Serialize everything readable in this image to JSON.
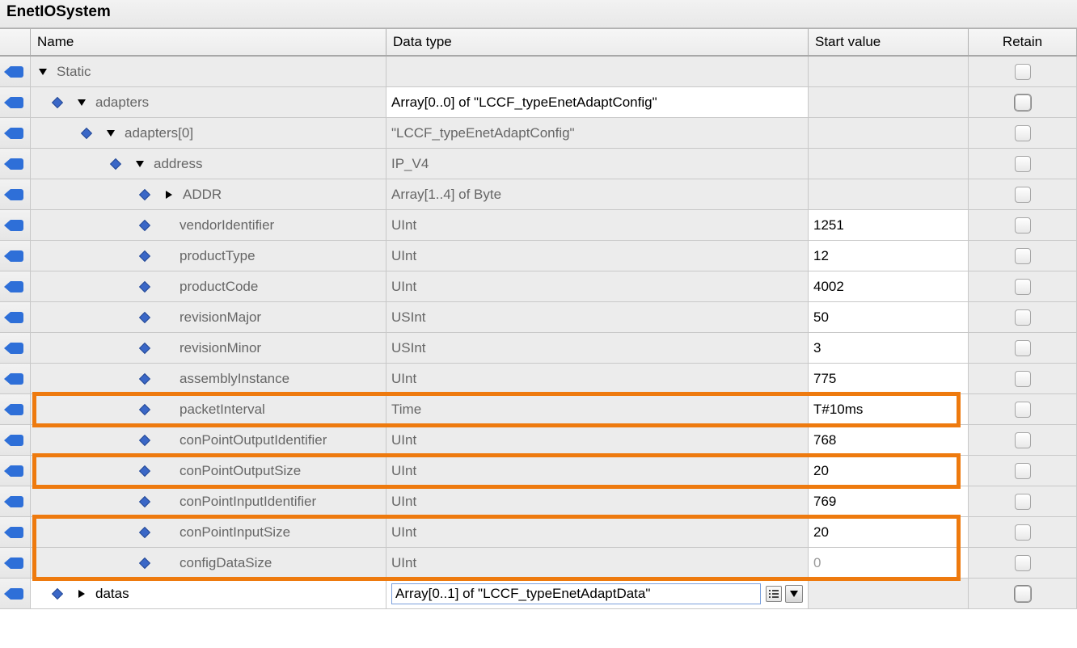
{
  "window_title": "EnetIOSystem",
  "columns": {
    "name": "Name",
    "datatype": "Data type",
    "start": "Start value",
    "retain": "Retain"
  },
  "rows": [
    {
      "id": "static",
      "indent": 0,
      "toggle": "down",
      "bullet": false,
      "name": "Static",
      "type": "",
      "start": "",
      "start_gray": true,
      "name_bg": "gray",
      "type_gray": true,
      "retain_thick": false,
      "highlight": false
    },
    {
      "id": "adapters",
      "indent": 1,
      "toggle": "down",
      "bullet": true,
      "name": "adapters",
      "type": "Array[0..0] of \"LCCF_typeEnetAdaptConfig\"",
      "start": "",
      "start_gray": true,
      "name_bg": "gray",
      "type_gray": false,
      "retain_thick": true,
      "highlight": false
    },
    {
      "id": "adapters0",
      "indent": 2,
      "toggle": "down",
      "bullet": true,
      "name": "adapters[0]",
      "type": "\"LCCF_typeEnetAdaptConfig\"",
      "start": "",
      "start_gray": true,
      "name_bg": "gray",
      "type_gray": true,
      "retain_thick": false,
      "highlight": false
    },
    {
      "id": "address",
      "indent": 3,
      "toggle": "down",
      "bullet": true,
      "name": "address",
      "type": "IP_V4",
      "start": "",
      "start_gray": true,
      "name_bg": "gray",
      "type_gray": true,
      "retain_thick": false,
      "highlight": false
    },
    {
      "id": "addr",
      "indent": 4,
      "toggle": "right",
      "bullet": true,
      "name": "ADDR",
      "type": "Array[1..4] of Byte",
      "start": "",
      "start_gray": true,
      "name_bg": "gray",
      "type_gray": true,
      "retain_thick": false,
      "highlight": false
    },
    {
      "id": "vendor",
      "indent": 4,
      "toggle": "none",
      "bullet": true,
      "name": "vendorIdentifier",
      "type": "UInt",
      "start": "1251",
      "start_gray": false,
      "name_bg": "gray",
      "type_gray": true,
      "retain_thick": false,
      "highlight": false
    },
    {
      "id": "ptype",
      "indent": 4,
      "toggle": "none",
      "bullet": true,
      "name": "productType",
      "type": "UInt",
      "start": "12",
      "start_gray": false,
      "name_bg": "gray",
      "type_gray": true,
      "retain_thick": false,
      "highlight": false
    },
    {
      "id": "pcode",
      "indent": 4,
      "toggle": "none",
      "bullet": true,
      "name": "productCode",
      "type": "UInt",
      "start": "4002",
      "start_gray": false,
      "name_bg": "gray",
      "type_gray": true,
      "retain_thick": false,
      "highlight": false
    },
    {
      "id": "revmaj",
      "indent": 4,
      "toggle": "none",
      "bullet": true,
      "name": "revisionMajor",
      "type": "USInt",
      "start": "50",
      "start_gray": false,
      "name_bg": "gray",
      "type_gray": true,
      "retain_thick": false,
      "highlight": false
    },
    {
      "id": "revmin",
      "indent": 4,
      "toggle": "none",
      "bullet": true,
      "name": "revisionMinor",
      "type": "USInt",
      "start": "3",
      "start_gray": false,
      "name_bg": "gray",
      "type_gray": true,
      "retain_thick": false,
      "highlight": false
    },
    {
      "id": "asm",
      "indent": 4,
      "toggle": "none",
      "bullet": true,
      "name": "assemblyInstance",
      "type": "UInt",
      "start": "775",
      "start_gray": false,
      "name_bg": "gray",
      "type_gray": true,
      "retain_thick": false,
      "highlight": false
    },
    {
      "id": "pkt",
      "indent": 4,
      "toggle": "none",
      "bullet": true,
      "name": "packetInterval",
      "type": "Time",
      "start": "T#10ms",
      "start_gray": false,
      "name_bg": "gray",
      "type_gray": true,
      "retain_thick": false,
      "highlight": "hl1"
    },
    {
      "id": "cpoid",
      "indent": 4,
      "toggle": "none",
      "bullet": true,
      "name": "conPointOutputIdentifier",
      "type": "UInt",
      "start": "768",
      "start_gray": false,
      "name_bg": "gray",
      "type_gray": true,
      "retain_thick": false,
      "highlight": false
    },
    {
      "id": "cposz",
      "indent": 4,
      "toggle": "none",
      "bullet": true,
      "name": "conPointOutputSize",
      "type": "UInt",
      "start": "20",
      "start_gray": false,
      "name_bg": "gray",
      "type_gray": true,
      "retain_thick": false,
      "highlight": "hl3"
    },
    {
      "id": "cpiid",
      "indent": 4,
      "toggle": "none",
      "bullet": true,
      "name": "conPointInputIdentifier",
      "type": "UInt",
      "start": "769",
      "start_gray": false,
      "name_bg": "gray",
      "type_gray": true,
      "retain_thick": false,
      "highlight": false
    },
    {
      "id": "cpisz",
      "indent": 4,
      "toggle": "none",
      "bullet": true,
      "name": "conPointInputSize",
      "type": "UInt",
      "start": "20",
      "start_gray": false,
      "name_bg": "gray",
      "type_gray": true,
      "retain_thick": false,
      "highlight": "hl5"
    },
    {
      "id": "cfgsz",
      "indent": 4,
      "toggle": "none",
      "bullet": true,
      "name": "configDataSize",
      "type": "UInt",
      "start": "0",
      "start_gray": false,
      "start_faded": true,
      "name_bg": "gray",
      "type_gray": true,
      "retain_thick": false,
      "highlight": false
    },
    {
      "id": "datas",
      "indent": 1,
      "toggle": "right",
      "bullet": true,
      "name": "datas",
      "type": "Array[0..1] of \"LCCF_typeEnetAdaptData\"",
      "start": "",
      "start_gray": true,
      "name_bg": "white",
      "type_gray": false,
      "retain_thick": true,
      "highlight": false,
      "type_editor": true
    }
  ]
}
